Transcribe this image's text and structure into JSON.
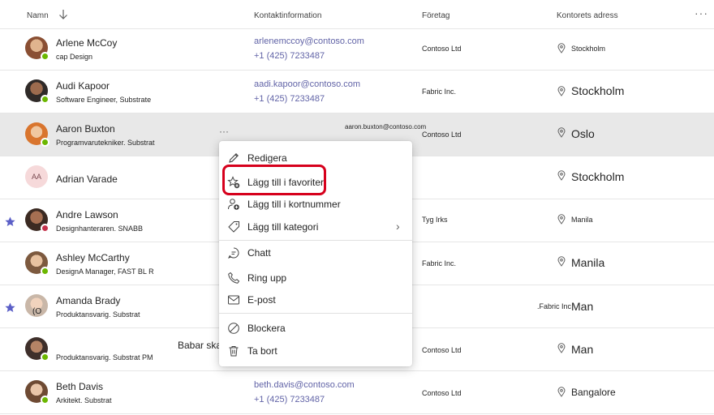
{
  "header": {
    "col_name": "Namn",
    "col_contact": "Kontaktinformation",
    "col_company": "Företag",
    "col_address": "Kontorets adress",
    "more": "···"
  },
  "rows": [
    {
      "name": "Arlene McCoy",
      "title": "cap Design",
      "email": "arlenemccoy@contoso.com",
      "phone": "+1 (425) 7233487",
      "company": "Contoso Ltd",
      "city": "Stockholm",
      "presence": "available",
      "favorite": false
    },
    {
      "name": "Audi Kapoor",
      "title": "Software Engineer, Substrate",
      "email": "aadi.kapoor@contoso.com",
      "phone": "+1 (425) 7233487",
      "company": "Fabric Inc.",
      "city": "Stockholm",
      "presence": "available",
      "favorite": false
    },
    {
      "name": "Aaron Buxton",
      "title": "Programvarutekniker. Substrat",
      "email_overlay": "aaron.buxton@contoso.com",
      "company": "Contoso Ltd",
      "city": "Oslo",
      "presence": "available",
      "favorite": false,
      "row_more": "···"
    },
    {
      "name": "Adrian Varade",
      "initials": "AA",
      "city": "Stockholm",
      "favorite": false
    },
    {
      "name": "Andre Lawson",
      "title": "Designhanteraren. SNABB",
      "company": "Tyg Irks",
      "city": "Manila",
      "presence": "busy",
      "favorite": true
    },
    {
      "name": "Ashley McCarthy",
      "title": "DesignA Manager, FAST BL R",
      "company": "Fabric Inc.",
      "city": "Manila",
      "presence": "available",
      "favorite": false
    },
    {
      "name": "Amanda Brady",
      "title": "Produktansvarig. Substrat",
      "company_overlay": ".Fabric Inc",
      "city": "Man",
      "favorite": true,
      "avatar_text": "(O"
    },
    {
      "name": "",
      "title": "Produktansvarig. Substrat PM",
      "company": "Contoso Ltd",
      "city": "Man",
      "presence": "available",
      "favorite": false
    },
    {
      "name": "Beth Davis",
      "title": "Arkitekt. Substrat",
      "email": "beth.davis@contoso.com",
      "phone": "+1 (425) 7233487",
      "company": "Contoso Ltd",
      "city": "Bangalore",
      "presence": "available",
      "favorite": false
    }
  ],
  "overflow_text": "Babar skammen",
  "context_menu": {
    "items": [
      {
        "label": "Redigera",
        "icon": "edit-icon"
      },
      {
        "label": "Lägg till i favoriter",
        "icon": "star-add-icon",
        "highlighted": true
      },
      {
        "label": "Lägg till i kortnummer",
        "icon": "speed-dial-add-icon"
      },
      {
        "label": "Lägg till kategori",
        "icon": "tag-icon",
        "submenu": "›"
      },
      {
        "label": "Chatt",
        "icon": "chat-icon"
      },
      {
        "label": "Ring upp",
        "icon": "phone-icon"
      },
      {
        "label": "E-post",
        "icon": "mail-icon"
      },
      {
        "label": "Blockera",
        "icon": "block-icon"
      },
      {
        "label": "Ta bort",
        "icon": "delete-icon"
      }
    ]
  },
  "colors": {
    "link": "#6264a7",
    "favorite_star": "#5b5fc7",
    "presence_available": "#6bb700",
    "presence_busy": "#c4314b",
    "highlight_border": "#d6001c",
    "hover_row": "#e8e8e8"
  }
}
